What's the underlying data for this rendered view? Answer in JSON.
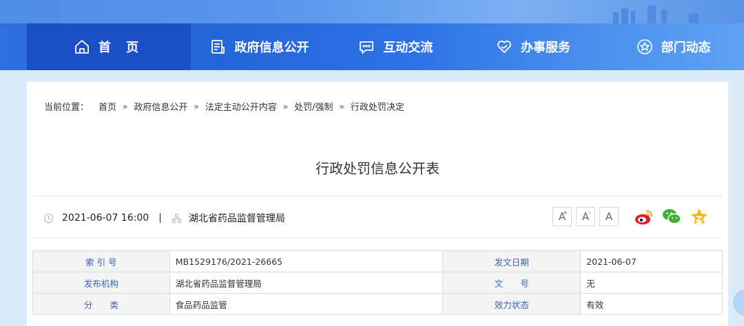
{
  "nav": {
    "items": [
      {
        "label": "首 页",
        "icon": "home-icon"
      },
      {
        "label": "政府信息公开",
        "icon": "document-icon"
      },
      {
        "label": "互动交流",
        "icon": "chat-icon"
      },
      {
        "label": "办事服务",
        "icon": "heart-icon"
      },
      {
        "label": "部门动态",
        "icon": "star-icon"
      }
    ],
    "active_color": "#1a4fc6"
  },
  "breadcrumb": {
    "prefix": "当前位置：",
    "items": [
      "首页",
      "政府信息公开",
      "法定主动公开内容",
      "处罚/强制",
      "行政处罚决定"
    ],
    "separator": "»"
  },
  "article": {
    "title": "行政处罚信息公开表",
    "date": "2021-06-07 16:00",
    "pipe": "|",
    "org": "湖北省药品监督管理局"
  },
  "tools": {
    "font_large": "A",
    "font_large_sup": "+",
    "font_small": "A",
    "font_small_sup": "-",
    "font_reset": "A",
    "share_icons": [
      "weibo-icon",
      "wechat-icon",
      "qzone-icon"
    ]
  },
  "info": {
    "rows": [
      {
        "l1": "索 引 号",
        "v1": "MB1529176/2021-26665",
        "l2": "发文日期",
        "v2": "2021-06-07"
      },
      {
        "l1": "发布机构",
        "v1": "湖北省药品监督管理局",
        "l2": "文　　号",
        "v2": "无"
      },
      {
        "l1": "分　　类",
        "v1": "食品药品监管",
        "l2": "效力状态",
        "v2": "有效"
      }
    ]
  }
}
